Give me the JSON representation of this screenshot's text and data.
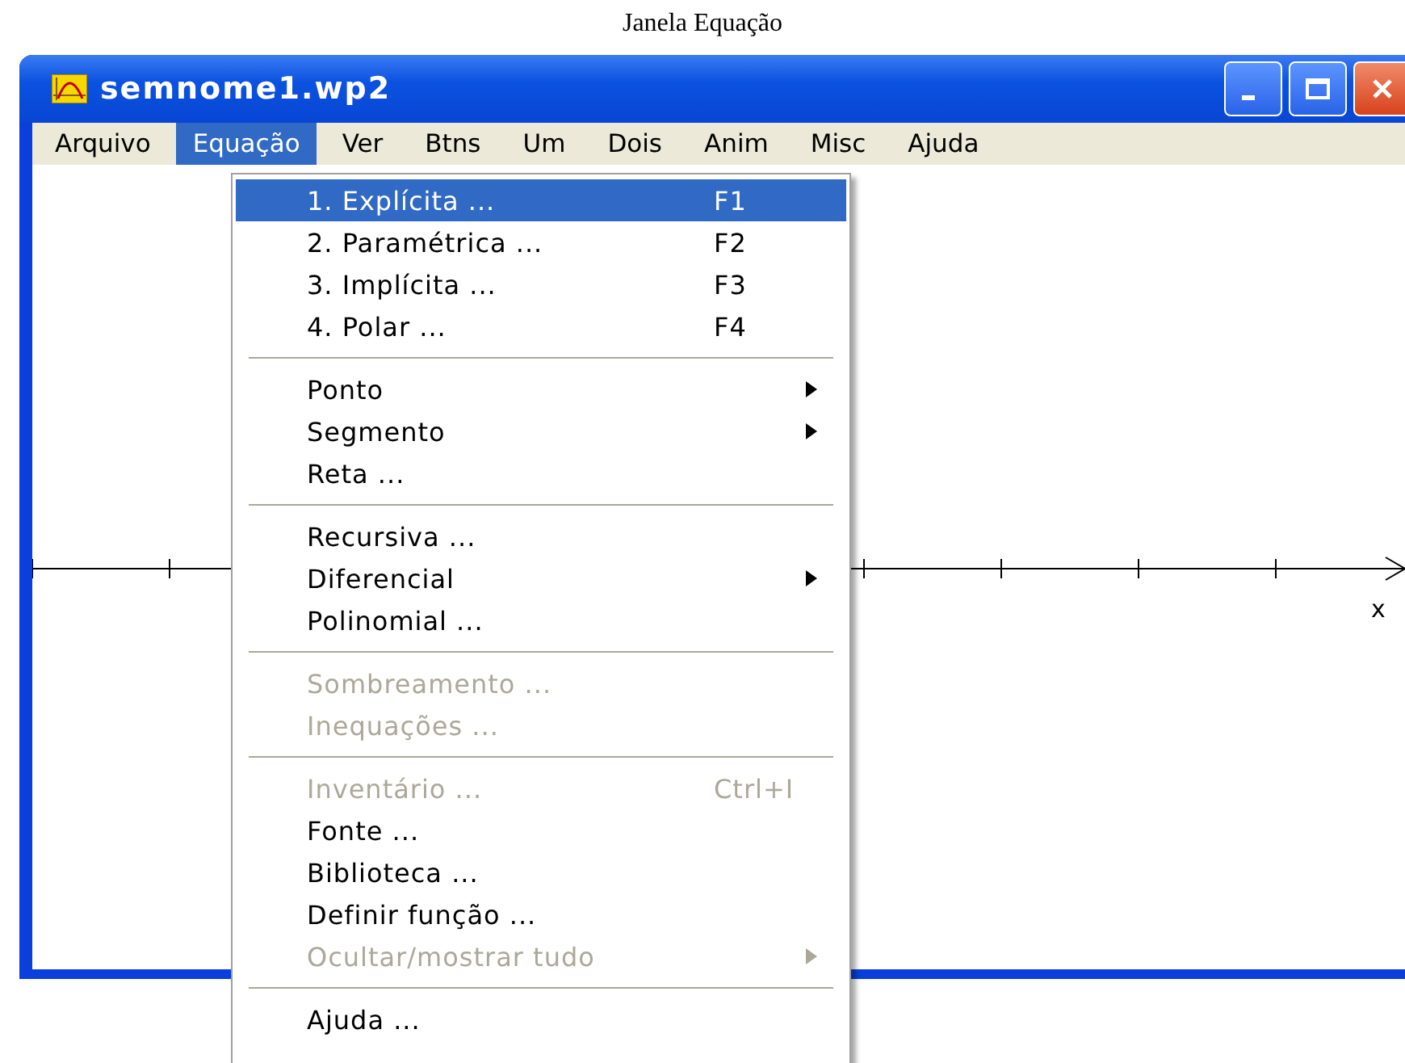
{
  "caption": "Janela Equação",
  "window": {
    "title": "semnome1.wp2"
  },
  "menu_bar": [
    {
      "label": "Arquivo",
      "selected": false
    },
    {
      "label": "Equação",
      "selected": true
    },
    {
      "label": "Ver",
      "selected": false
    },
    {
      "label": "Btns",
      "selected": false
    },
    {
      "label": "Um",
      "selected": false
    },
    {
      "label": "Dois",
      "selected": false
    },
    {
      "label": "Anim",
      "selected": false
    },
    {
      "label": "Misc",
      "selected": false
    },
    {
      "label": "Ajuda",
      "selected": false
    }
  ],
  "dropdown": [
    {
      "kind": "item",
      "label": "1. Explícita ...",
      "shortcut": "F1",
      "selected": true,
      "disabled": false,
      "submenu": false
    },
    {
      "kind": "item",
      "label": "2. Paramétrica ...",
      "shortcut": "F2",
      "selected": false,
      "disabled": false,
      "submenu": false
    },
    {
      "kind": "item",
      "label": "3. Implícita ...",
      "shortcut": "F3",
      "selected": false,
      "disabled": false,
      "submenu": false
    },
    {
      "kind": "item",
      "label": "4. Polar ...",
      "shortcut": "F4",
      "selected": false,
      "disabled": false,
      "submenu": false
    },
    {
      "kind": "separator"
    },
    {
      "kind": "item",
      "label": "Ponto",
      "selected": false,
      "disabled": false,
      "submenu": true
    },
    {
      "kind": "item",
      "label": "Segmento",
      "selected": false,
      "disabled": false,
      "submenu": true
    },
    {
      "kind": "item",
      "label": "Reta ...",
      "selected": false,
      "disabled": false,
      "submenu": false
    },
    {
      "kind": "separator"
    },
    {
      "kind": "item",
      "label": "Recursiva ...",
      "selected": false,
      "disabled": false,
      "submenu": false
    },
    {
      "kind": "item",
      "label": "Diferencial",
      "selected": false,
      "disabled": false,
      "submenu": true
    },
    {
      "kind": "item",
      "label": "Polinomial ...",
      "selected": false,
      "disabled": false,
      "submenu": false
    },
    {
      "kind": "separator"
    },
    {
      "kind": "item",
      "label": "Sombreamento ...",
      "selected": false,
      "disabled": true,
      "submenu": false
    },
    {
      "kind": "item",
      "label": "Inequações ...",
      "selected": false,
      "disabled": true,
      "submenu": false
    },
    {
      "kind": "separator"
    },
    {
      "kind": "item",
      "label": "Inventário ...",
      "shortcut": "Ctrl+I",
      "selected": false,
      "disabled": true,
      "submenu": false
    },
    {
      "kind": "item",
      "label": "Fonte ...",
      "selected": false,
      "disabled": false,
      "submenu": false
    },
    {
      "kind": "item",
      "label": "Biblioteca ...",
      "selected": false,
      "disabled": false,
      "submenu": false
    },
    {
      "kind": "item",
      "label": "Definir função ...",
      "selected": false,
      "disabled": false,
      "submenu": false
    },
    {
      "kind": "item",
      "label": "Ocultar/mostrar tudo",
      "selected": false,
      "disabled": true,
      "submenu": true
    },
    {
      "kind": "separator"
    },
    {
      "kind": "item",
      "label": "Ajuda ...",
      "selected": false,
      "disabled": false,
      "submenu": false
    }
  ],
  "graph": {
    "axis_label": "x"
  }
}
